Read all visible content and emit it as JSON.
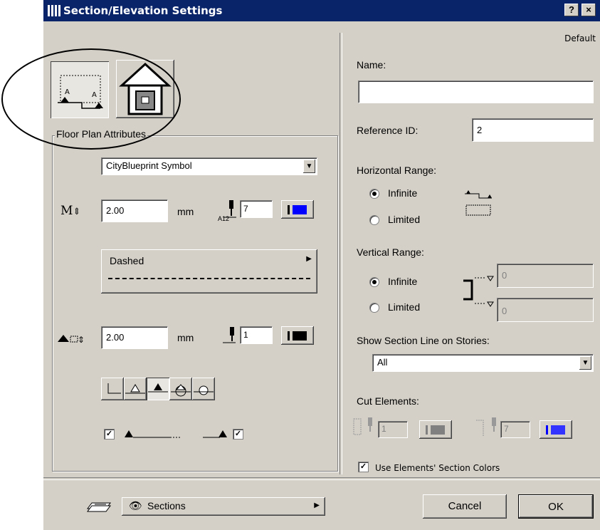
{
  "window": {
    "title": "Section/Elevation Settings",
    "help_glyph": "?",
    "close_glyph": "×",
    "preset": "Default"
  },
  "floor_plan": {
    "group_label": "Floor Plan Attributes",
    "symbol": "CityBlueprint Symbol",
    "marker_size": {
      "value": "2.00",
      "unit": "mm"
    },
    "marker_pen": {
      "label": "A12",
      "value": "7",
      "color": "#0000ff"
    },
    "line_type": {
      "label": "Dashed"
    },
    "line_size": {
      "value": "2.00",
      "unit": "mm"
    },
    "line_pen": {
      "value": "1",
      "color": "#000000"
    },
    "show_start_marker": true,
    "show_end_marker": true
  },
  "right": {
    "name": {
      "label": "Name:",
      "value": ""
    },
    "reference_id": {
      "label": "Reference ID:",
      "value": "2"
    },
    "horizontal_range": {
      "label": "Horizontal Range:",
      "options": [
        "Infinite",
        "Limited"
      ],
      "selected": "Infinite"
    },
    "vertical_range": {
      "label": "Vertical Range:",
      "options": [
        "Infinite",
        "Limited"
      ],
      "selected": "Infinite",
      "top_value": "0",
      "bottom_value": "0"
    },
    "show_on_stories": {
      "label": "Show Section Line on Stories:",
      "value": "All"
    },
    "cut_elements": {
      "label": "Cut Elements:",
      "pen1": "1",
      "pen2": "7",
      "color1": "#808080",
      "color2": "#0000ff"
    },
    "use_section_colors": {
      "label": "Use Elements' Section Colors",
      "checked": true
    }
  },
  "footer": {
    "panel_selector": "Sections",
    "cancel_label": "Cancel",
    "ok_label": "OK"
  }
}
